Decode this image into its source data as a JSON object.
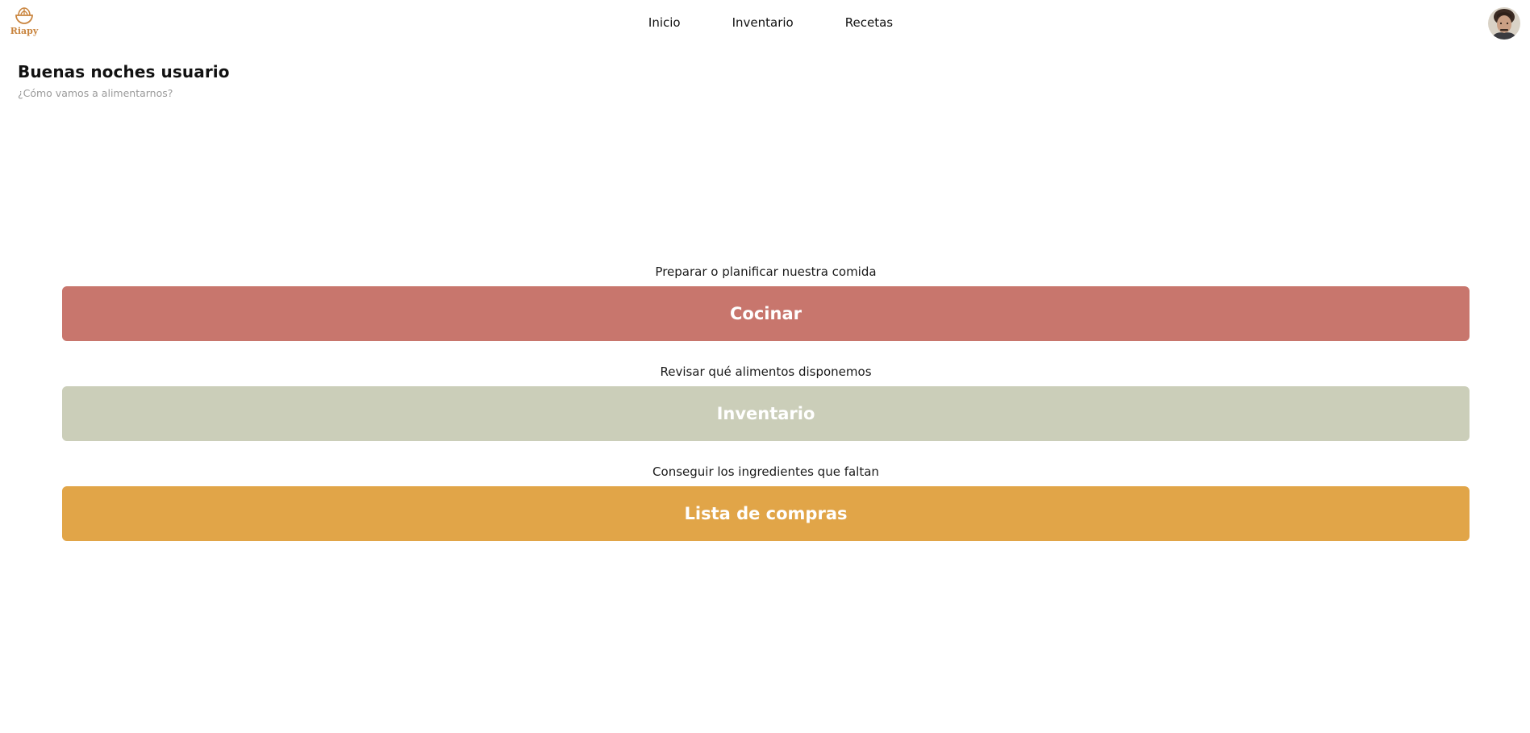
{
  "app": {
    "logo_text": "Riapy",
    "icon": "salad-bowl-icon"
  },
  "nav": {
    "items": [
      {
        "label": "Inicio"
      },
      {
        "label": "Inventario"
      },
      {
        "label": "Recetas"
      }
    ]
  },
  "user": {
    "avatar_icon": "user-avatar"
  },
  "header": {
    "greeting": "Buenas noches usuario",
    "subtitle": "¿Cómo vamos a alimentarnos?"
  },
  "actions": [
    {
      "description": "Preparar o planificar nuestra comida",
      "label": "Cocinar",
      "color": "#c8766d"
    },
    {
      "description": "Revisar qué alimentos disponemos",
      "label": "Inventario",
      "color": "#cbceb9"
    },
    {
      "description": "Conseguir los ingredientes que faltan",
      "label": "Lista de compras",
      "color": "#e1a548"
    }
  ]
}
